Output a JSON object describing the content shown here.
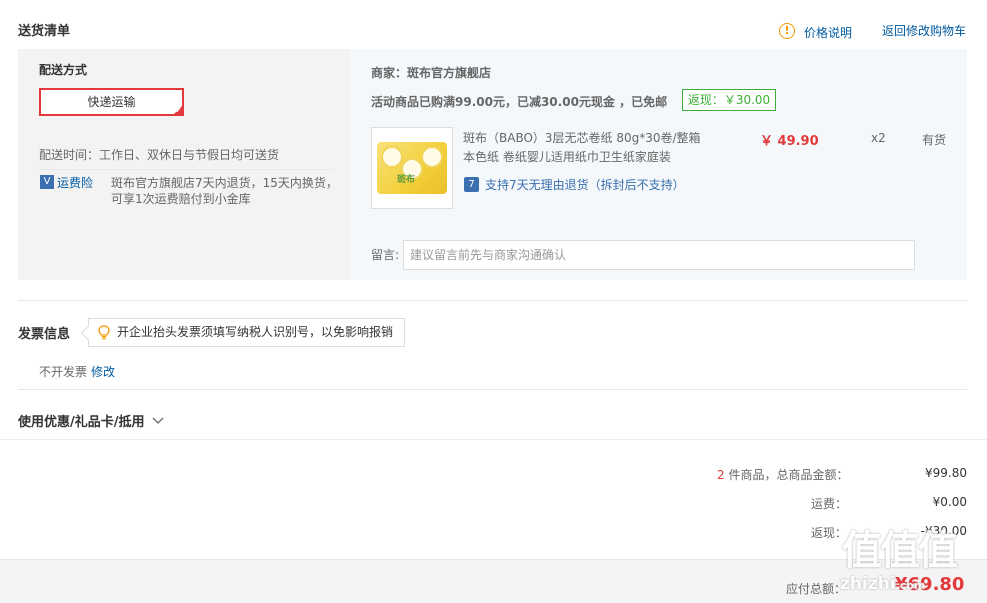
{
  "header": {
    "title": "送货清单",
    "price_explain": "价格说明",
    "back_to_cart": "返回修改购物车"
  },
  "delivery": {
    "method_label": "配送方式",
    "method_selected": "快递运输",
    "time_text": "配送时间：工作日、双休日与节假日均可送货",
    "insurance_label": "运费险",
    "insurance_desc_1": "斑布官方旗舰店7天内退货，15天内换货，",
    "insurance_desc_2": "可享1次运费赔付到小金库"
  },
  "shop": {
    "merchant": "商家：斑布官方旗舰店",
    "promo": "活动商品已购满99.00元，已减30.00元现金 ，已免邮",
    "rebate": "返现：￥30.00"
  },
  "product": {
    "name_line1": "斑布（BABO）3层无芯卷纸 80g*30卷/整箱",
    "name_line2": "本色纸 卷纸婴儿适用纸巾卫生纸家庭装",
    "price": "￥ 49.90",
    "qty": "x2",
    "stock": "有货",
    "return_policy": "支持7天无理由退货（拆封后不支持）",
    "img_brand": "斑布"
  },
  "note": {
    "label": "留言:",
    "placeholder": "建议留言前先与商家沟通确认"
  },
  "invoice": {
    "title": "发票信息",
    "tip": "开企业抬头发票须填写纳税人识别号，以免影响报销",
    "status": "不开发票",
    "edit": "修改"
  },
  "coupon": {
    "title": "使用优惠/礼品卡/抵用"
  },
  "summary": {
    "count": "2",
    "count_suffix": " 件商品，总商品金额：",
    "goods_total": "¥99.80",
    "shipping_label": "运费：",
    "shipping": "¥0.00",
    "rebate_label": "返现：",
    "rebate": "-¥30.00",
    "payable_label": "应付总额：",
    "payable": "¥69.80"
  },
  "watermark": {
    "text": "值值值",
    "site": "zhizhi",
    "site_suffix": ".com"
  },
  "colors": {
    "accent_red": "#e4393c",
    "link_blue": "#005aa0",
    "rebate_green": "#3cb035",
    "warn_orange": "#f39800"
  }
}
